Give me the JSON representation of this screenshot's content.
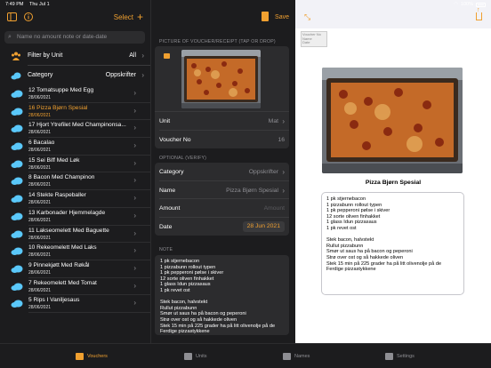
{
  "status": {
    "time": "7:49 PM",
    "date": "Thu Jul 1",
    "battery": "100%"
  },
  "pane1": {
    "select_label": "Select",
    "search_placeholder": "Name no amount note or date-date",
    "filter_unit_label": "Filter by Unit",
    "filter_unit_value": "All",
    "category_label": "Category",
    "category_value": "Oppskrifter",
    "items": [
      {
        "title": "12 Tomatsuppe Med Egg",
        "date": "28/06/2021"
      },
      {
        "title": "16 Pizza Bjørn Spesial",
        "date": "28/06/2021",
        "selected": true
      },
      {
        "title": "17 Hjort Ytrefilet Med Champinonsa...",
        "date": "28/06/2021"
      },
      {
        "title": "6 Bacalao",
        "date": "28/06/2021"
      },
      {
        "title": "15 Sei Biff Med Løk",
        "date": "28/06/2021"
      },
      {
        "title": "8 Bacon Med Champinon",
        "date": "28/06/2021"
      },
      {
        "title": "14 Stekte Raspeballer",
        "date": "28/06/2021"
      },
      {
        "title": "13 Karbonader Hjemmelagde",
        "date": "28/06/2021"
      },
      {
        "title": "11 Lakseomelett Med Baguette",
        "date": "28/06/2021"
      },
      {
        "title": "10 Rekeomelett Med Laks",
        "date": "28/06/2021"
      },
      {
        "title": "9 Pinnekjøtt Med Røkål",
        "date": "28/06/2021"
      },
      {
        "title": "7 Rekeomelett Med Tomat",
        "date": "28/06/2021"
      },
      {
        "title": "5 Rips I Vaniljesaus",
        "date": "28/06/2021"
      }
    ]
  },
  "pane2": {
    "save_label": "Save",
    "picture_header": "PICTURE OF VOUCHER/RECEIPT (TAP OR DROP)",
    "unit_label": "Unit",
    "unit_value": "Mat",
    "voucher_label": "Voucher No",
    "voucher_value": "16",
    "optional_header": "OPTIONAL (VERIFY)",
    "category_label": "Category",
    "category_value": "Oppskrifter",
    "name_label": "Name",
    "name_value": "Pizza Bjørn Spesial",
    "amount_label": "Amount",
    "amount_placeholder": "Amount",
    "date_label": "Date",
    "date_value": "28 Jun 2021",
    "note_header": "NOTE",
    "note_text": "1 pk stjernebacon\n1 pizzabunn rollout typen\n1 pk pepperoni pølse i skiver\n12 sorte oliven finhakket\n1 glass Idun pizzasaus\n1 pk revet ost\n\nStek bacon, halvstekt\nRullut pizzabunn\nSmør ut saus ha på bacon og peperoni\nStrø over ost og så hakkede oliven\nStek 15 min på 225 grader ha på litt olivenolje på de Ferdige pizzastykkene"
  },
  "pane3": {
    "title": "Pizza Bjørn Spesial",
    "watermark": "Voucher No\nName\nDate",
    "note_text": "1 pk stjernebacon\n1 pizzabunn rollout typen\n1 pk pepperoni pølse i skiver\n12 sorte oliven finhakket\n1 glass Idun pizzasaus\n1 pk revet ost\n\nStek bacon, halvstekt\nRullut pizzabunn\nSmør ut saus ha på bacon og peperoni\nStrø over ost og så hakkede oliven\nStek 15 min på 225 grader ha på litt olivenolje på de Ferdige pizzastykkene"
  },
  "tabs": [
    {
      "label": "Vouchers",
      "icon": "vouchers-icon",
      "active": true
    },
    {
      "label": "Units",
      "icon": "units-icon",
      "active": false
    },
    {
      "label": "Names",
      "icon": "names-icon",
      "active": false
    },
    {
      "label": "Settings",
      "icon": "settings-icon",
      "active": false
    }
  ],
  "colors": {
    "accent": "#f0a030",
    "background": "#1c1c1e",
    "card": "#2c2c2e"
  }
}
